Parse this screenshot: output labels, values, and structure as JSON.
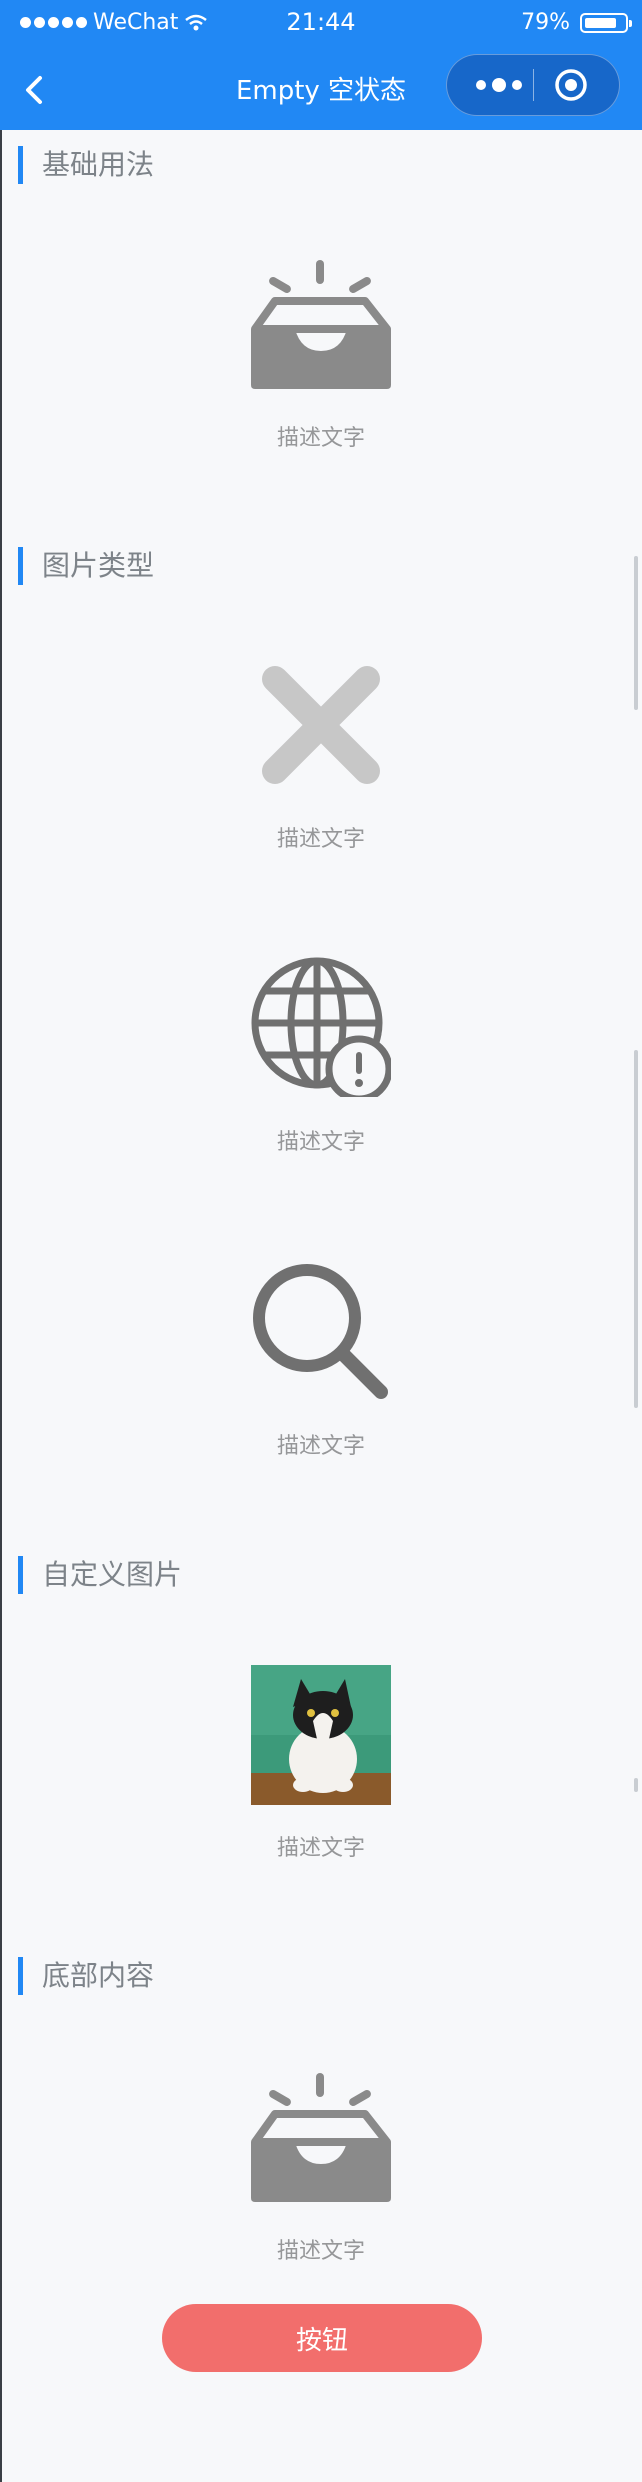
{
  "status_bar": {
    "carrier": "WeChat",
    "time": "21:44",
    "battery": "79%",
    "battery_level": 0.79
  },
  "nav": {
    "title": "Empty 空状态",
    "icons": [
      "back-icon",
      "more-dots-icon",
      "close-target-icon"
    ]
  },
  "sections": [
    {
      "title": "基础用法",
      "items": [
        {
          "image": "inbox-icon",
          "description": "描述文字"
        }
      ]
    },
    {
      "title": "图片类型",
      "items": [
        {
          "image": "error-x-icon",
          "description": "描述文字"
        },
        {
          "image": "network-error-globe-icon",
          "description": "描述文字"
        },
        {
          "image": "search-icon",
          "description": "描述文字"
        }
      ]
    },
    {
      "title": "自定义图片",
      "items": [
        {
          "image": "custom-cat-image",
          "description": "描述文字"
        }
      ]
    },
    {
      "title": "底部内容",
      "items": [
        {
          "image": "inbox-icon",
          "description": "描述文字",
          "button_label": "按钮"
        }
      ]
    }
  ],
  "colors": {
    "primary": "#2188f4",
    "button": "#f26e6c",
    "background": "#f7f8fa",
    "icon": "#8a8a8a"
  }
}
